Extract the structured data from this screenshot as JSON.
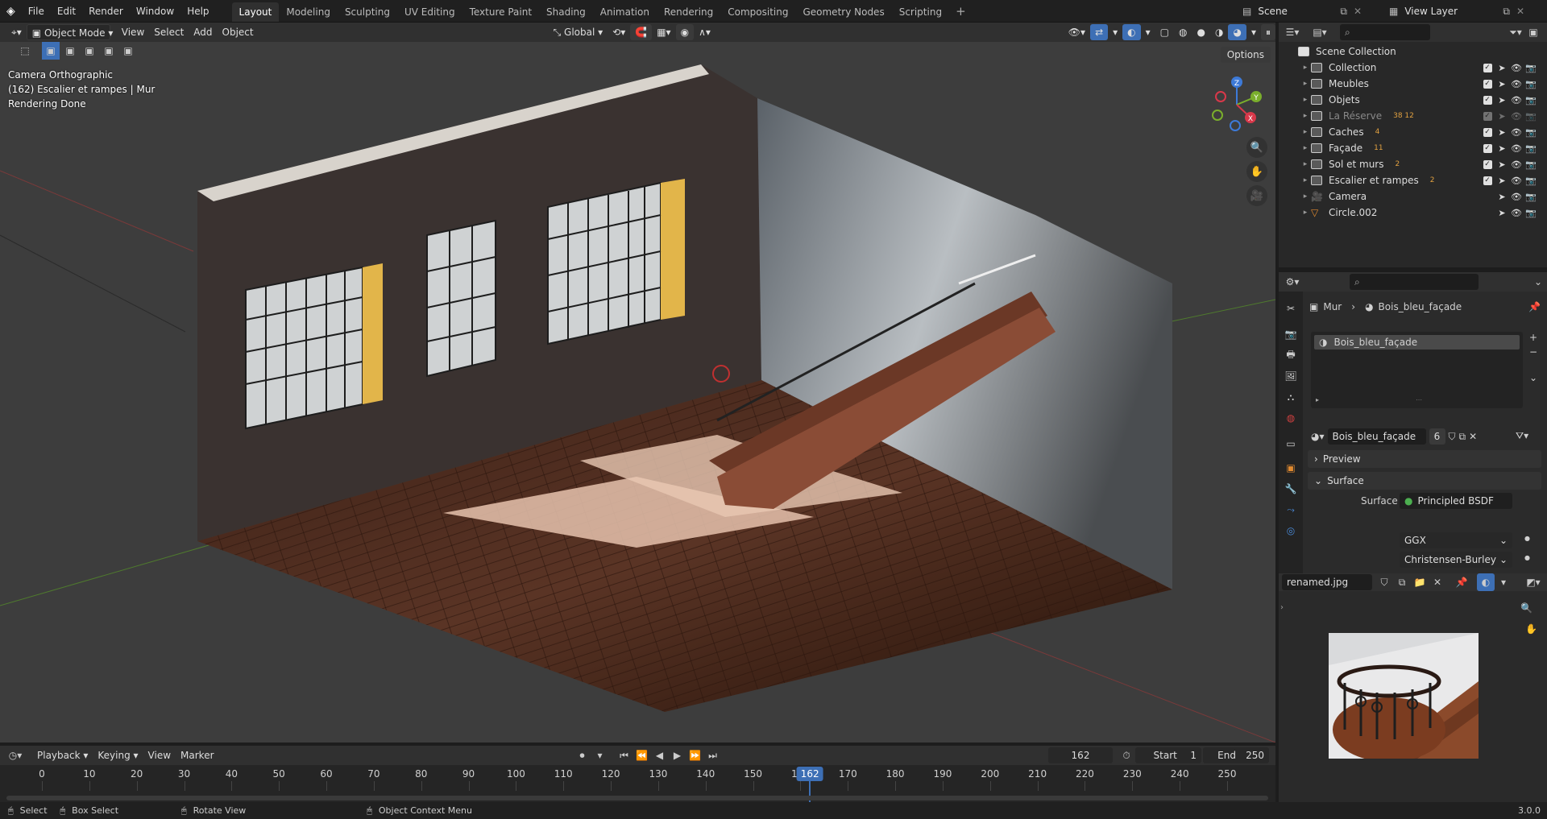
{
  "menubar": {
    "items": [
      "File",
      "Edit",
      "Render",
      "Window",
      "Help"
    ],
    "workspaces": [
      "Layout",
      "Modeling",
      "Sculpting",
      "UV Editing",
      "Texture Paint",
      "Shading",
      "Animation",
      "Rendering",
      "Compositing",
      "Geometry Nodes",
      "Scripting"
    ],
    "active_workspace": "Layout",
    "add_symbol": "+",
    "scene_name": "Scene",
    "view_layer": "View Layer"
  },
  "viewport_header": {
    "mode": "Object Mode",
    "menus": [
      "View",
      "Select",
      "Add",
      "Object"
    ],
    "transform_orientation": "Global",
    "options_label": "Options"
  },
  "viewport": {
    "overlay_lines": [
      "Camera Orthographic",
      "(162) Escalier et rampes | Mur",
      "Rendering Done"
    ],
    "gizmo_axes": {
      "x": "X",
      "y": "Y",
      "z": "Z"
    }
  },
  "outliner": {
    "root": "Scene Collection",
    "items": [
      {
        "name": "Collection",
        "type": "collection",
        "dim": false,
        "badge": ""
      },
      {
        "name": "Meubles",
        "type": "collection",
        "dim": false,
        "badge": ""
      },
      {
        "name": "Objets",
        "type": "collection",
        "dim": false,
        "badge": ""
      },
      {
        "name": "La Réserve",
        "type": "collection",
        "dim": true,
        "badge": "38 12"
      },
      {
        "name": "Caches",
        "type": "collection",
        "dim": false,
        "badge": "4"
      },
      {
        "name": "Façade",
        "type": "collection",
        "dim": false,
        "badge": "11"
      },
      {
        "name": "Sol et murs",
        "type": "collection",
        "dim": false,
        "badge": "2"
      },
      {
        "name": "Escalier et rampes",
        "type": "collection",
        "dim": false,
        "badge": "2"
      },
      {
        "name": "Camera",
        "type": "camera",
        "dim": false,
        "badge": ""
      },
      {
        "name": "Circle.002",
        "type": "mesh",
        "dim": false,
        "badge": ""
      }
    ]
  },
  "properties": {
    "breadcrumb_object": "Mur",
    "breadcrumb_material": "Bois_bleu_façade",
    "slot_name": "Bois_bleu_façade",
    "material_name": "Bois_bleu_façade",
    "user_count": "6",
    "panel_preview": "Preview",
    "panel_surface": "Surface",
    "surface_label": "Surface",
    "surface_value": "Principled BSDF",
    "distribution": "GGX",
    "subsurface_method": "Christensen-Burley"
  },
  "image_editor": {
    "image_name": "renamed.jpg"
  },
  "timeline": {
    "menus": [
      "Playback",
      "Keying",
      "View",
      "Marker"
    ],
    "current_frame": "162",
    "start_label": "Start",
    "start_value": "1",
    "end_label": "End",
    "end_value": "250",
    "ticks": [
      0,
      10,
      20,
      30,
      40,
      50,
      60,
      70,
      80,
      90,
      100,
      110,
      120,
      130,
      140,
      150,
      160,
      170,
      180,
      190,
      200,
      210,
      220,
      230,
      240,
      250
    ],
    "frame_badge": "162"
  },
  "statusbar": {
    "select": "Select",
    "box_select": "Box Select",
    "rotate_view": "Rotate View",
    "context_menu": "Object Context Menu",
    "version": "3.0.0"
  }
}
